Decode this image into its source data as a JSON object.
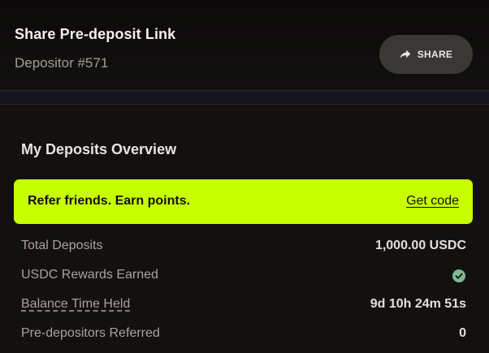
{
  "share": {
    "title": "Share Pre-deposit Link",
    "subtitle": "Depositor #571",
    "button_label": "SHARE",
    "button_icon": "share-arrow-icon"
  },
  "overview": {
    "title": "My Deposits Overview",
    "banner": {
      "text": "Refer friends. Earn points.",
      "link_label": "Get code",
      "color": "#c7ff00"
    },
    "stats": [
      {
        "label": "Total Deposits",
        "value": "1,000.00 USDC"
      },
      {
        "label": "USDC Rewards Earned",
        "value_icon": "check-circle-icon",
        "icon_color": "#7fb98f"
      },
      {
        "label": "Balance Time Held",
        "value": "9d 10h 24m 51s"
      },
      {
        "label": "Pre-depositors Referred",
        "value": "0"
      }
    ]
  }
}
